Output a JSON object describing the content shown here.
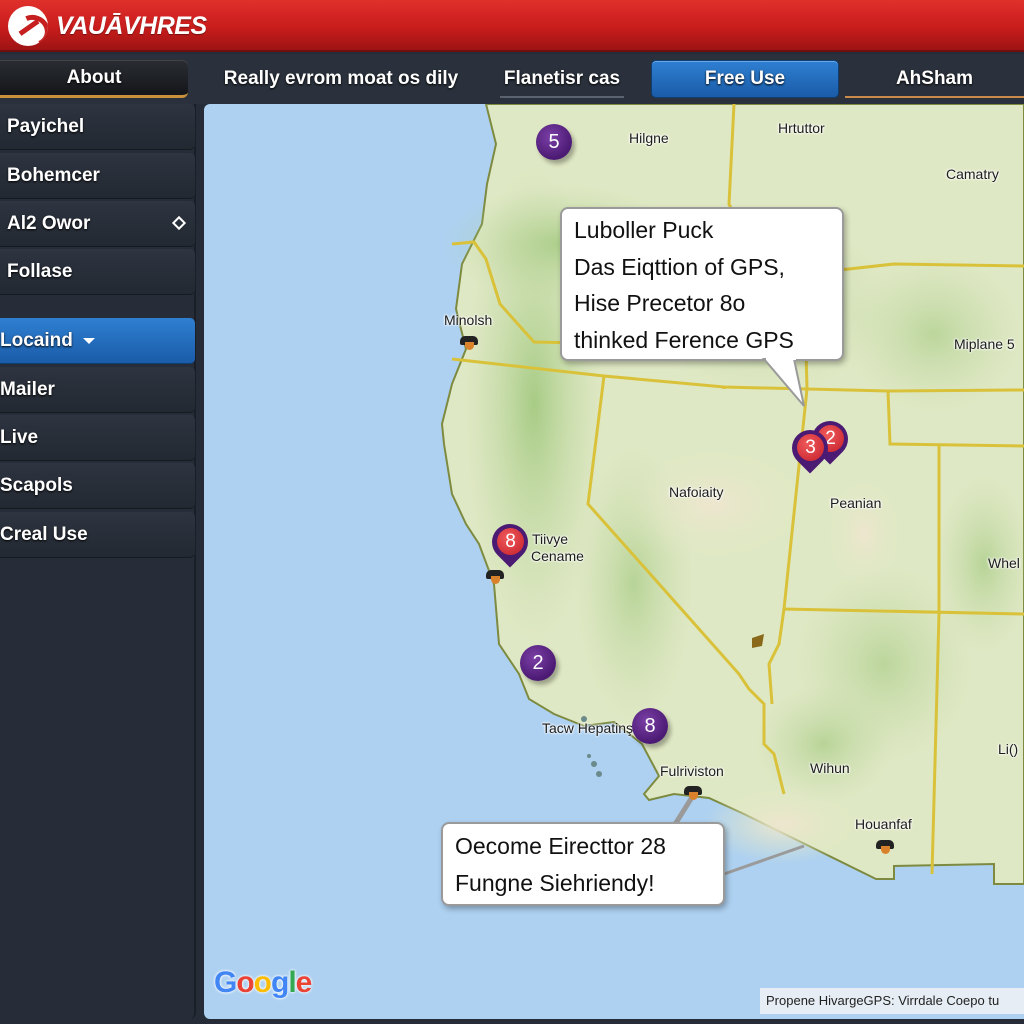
{
  "app": {
    "brand": "VAUĀVHRES"
  },
  "topnav": {
    "tabs": [
      {
        "label": "About",
        "state": "selected"
      },
      {
        "label": "Really evrom moat os dily"
      },
      {
        "label": "Flanetisr cas"
      },
      {
        "label": "Free Use",
        "state": "active"
      },
      {
        "label": "AhSham"
      }
    ]
  },
  "sidebar": {
    "items": [
      {
        "label": "Payichel"
      },
      {
        "label": "Bohemcer"
      },
      {
        "label": "Al2 Owor",
        "icon": "diamond-icon"
      },
      {
        "label": "Follase"
      },
      {
        "label": "Locaind",
        "icon": "chevron-down-icon",
        "state": "active"
      },
      {
        "label": "Mailer"
      },
      {
        "label": "Live"
      },
      {
        "label": "Scapols"
      },
      {
        "label": "Creal Use"
      }
    ]
  },
  "map": {
    "labels": [
      "Hilgne",
      "Hrtuttor",
      "Camatry",
      "Minolsh",
      "Miplane 5",
      "Nafoiaity",
      "Peanian",
      "Tiivye",
      "Cename",
      "Whel",
      "Tacw Hepatinş",
      "Fulriviston",
      "Wihun",
      "Houanfaf",
      "Li()"
    ],
    "clusters": [
      "5",
      "2",
      "8"
    ],
    "pins": [
      "2",
      "3",
      "8"
    ],
    "callouts": [
      {
        "lines": [
          "Luboller Puck",
          "Das Eiqttion of GPS,",
          "Hise Precetor 8o",
          "thinked Ference GPS"
        ]
      },
      {
        "lines": [
          "Oecome Eirecttor 28",
          "Fungne Siehriendy!"
        ]
      }
    ],
    "google_logo": {
      "letters": [
        "G",
        "o",
        "o",
        "g",
        "l",
        "e"
      ],
      "colors": [
        "#4285f4",
        "#ea4335",
        "#fbbc05",
        "#4285f4",
        "#34a853",
        "#ea4335"
      ]
    },
    "attribution": "Propene HivargeGPS: Virrdale  Coepo tu"
  },
  "colors": {
    "header_red": "#c81d1c",
    "accent_blue": "#1f6bbf",
    "sidebar_bg": "#262d38",
    "water": "#aed1f1",
    "land": "#dfe8c4",
    "border_yellow": "#d9c23a",
    "cluster_purple": "#4b1a73",
    "pin_red": "#d02a35"
  }
}
